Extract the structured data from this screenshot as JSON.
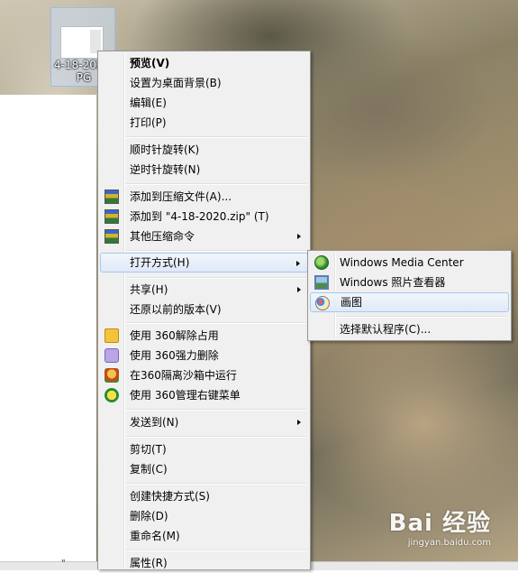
{
  "desktop_icon": {
    "label": "4-18-2020.\nPG"
  },
  "context_menu": {
    "items": [
      {
        "label": "预览(V)"
      },
      {
        "label": "设置为桌面背景(B)"
      },
      {
        "label": "编辑(E)"
      },
      {
        "label": "打印(P)"
      },
      {
        "label": "顺时针旋转(K)"
      },
      {
        "label": "逆时针旋转(N)"
      },
      {
        "label": "添加到压缩文件(A)..."
      },
      {
        "label": "添加到 \"4-18-2020.zip\" (T)"
      },
      {
        "label": "其他压缩命令"
      },
      {
        "label": "打开方式(H)"
      },
      {
        "label": "共享(H)"
      },
      {
        "label": "还原以前的版本(V)"
      },
      {
        "label": "使用 360解除占用"
      },
      {
        "label": "使用 360强力删除"
      },
      {
        "label": "在360隔离沙箱中运行"
      },
      {
        "label": "使用 360管理右键菜单"
      },
      {
        "label": "发送到(N)"
      },
      {
        "label": "剪切(T)"
      },
      {
        "label": "复制(C)"
      },
      {
        "label": "创建快捷方式(S)"
      },
      {
        "label": "删除(D)"
      },
      {
        "label": "重命名(M)"
      },
      {
        "label": "属性(R)"
      }
    ]
  },
  "open_with_submenu": {
    "items": [
      {
        "label": "Windows Media Center"
      },
      {
        "label": "Windows 照片查看器"
      },
      {
        "label": "画图"
      },
      {
        "label": "选择默认程序(C)..."
      }
    ]
  },
  "watermark": {
    "brand": "Bai 经验",
    "url": "jingyan.baidu.com"
  },
  "taskbar": {
    "text": "\""
  }
}
